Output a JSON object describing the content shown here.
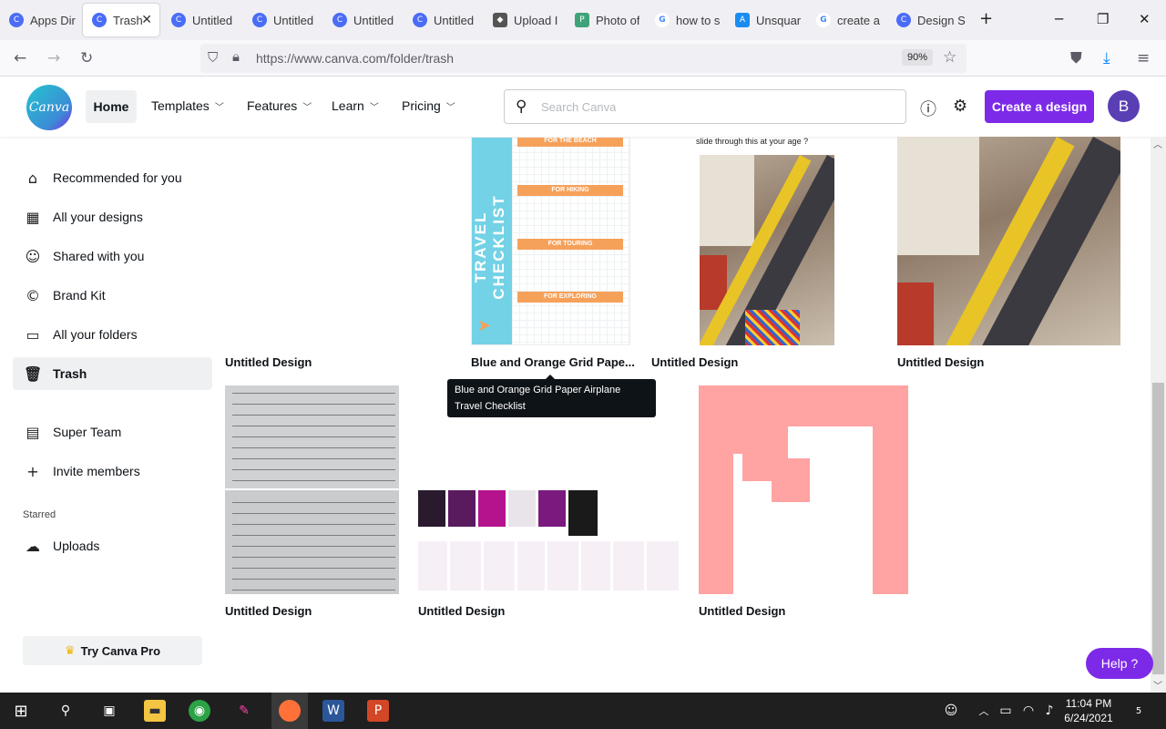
{
  "browser": {
    "tabs": [
      {
        "title": "Apps Dir",
        "icon": "canva-favicon"
      },
      {
        "title": "Trash",
        "icon": "canva-favicon",
        "active": true
      },
      {
        "title": "Untitled",
        "icon": "canva-favicon"
      },
      {
        "title": "Untitled",
        "icon": "canva-favicon"
      },
      {
        "title": "Untitled",
        "icon": "canva-favicon"
      },
      {
        "title": "Untitled",
        "icon": "canva-favicon"
      },
      {
        "title": "Upload I",
        "icon": "layers-favicon"
      },
      {
        "title": "Photo of",
        "icon": "photo-favicon"
      },
      {
        "title": "how to s",
        "icon": "google-favicon"
      },
      {
        "title": "Unsquar",
        "icon": "appstore-favicon"
      },
      {
        "title": "create a",
        "icon": "google-favicon"
      },
      {
        "title": "Design S",
        "icon": "canva-favicon"
      }
    ],
    "url": "https://www.canva.com/folder/trash",
    "zoom": "90%"
  },
  "header": {
    "logo_text": "Canva",
    "home_label": "Home",
    "nav": [
      "Templates",
      "Features",
      "Learn",
      "Pricing"
    ],
    "search_placeholder": "Search Canva",
    "create_label": "Create a design",
    "avatar_initial": "B"
  },
  "sidebar": {
    "items": [
      {
        "label": "Recommended for you",
        "icon": "home-icon"
      },
      {
        "label": "All your designs",
        "icon": "grid-icon"
      },
      {
        "label": "Shared with you",
        "icon": "people-icon"
      },
      {
        "label": "Brand Kit",
        "icon": "brandkit-icon"
      },
      {
        "label": "All your folders",
        "icon": "folder-icon"
      },
      {
        "label": "Trash",
        "icon": "trash-icon",
        "active": true
      },
      {
        "label": "Super Team",
        "icon": "building-icon"
      },
      {
        "label": "Invite members",
        "icon": "plus-icon"
      }
    ],
    "starred_heading": "Starred",
    "starred_items": [
      {
        "label": "Uploads",
        "icon": "cloud-upload-icon"
      }
    ],
    "try_pro": "Try Canva Pro"
  },
  "designs": {
    "row1": [
      "Untitled Design",
      "Blue and Orange Grid Pape...",
      "Untitled Design",
      "Untitled Design"
    ],
    "row2": [
      "Untitled Design",
      "Untitled Design",
      "Untitled Design"
    ],
    "tooltip": "Blue and Orange Grid Paper Airplane Travel Checklist",
    "travel": {
      "vertical_title": "TRAVEL CHECKLIST",
      "bars": [
        "FOR THE BEACH",
        "FOR HIKING",
        "FOR TOURING",
        "FOR EXPLORING"
      ]
    },
    "escalator_caption": "slide through this at your age ?"
  },
  "help_label": "Help ?",
  "taskbar": {
    "time": "11:04 PM",
    "date": "6/24/2021",
    "notifications": "5"
  },
  "colors": {
    "brand_purple": "#7d2ae8",
    "canva_teal": "#25c4cf",
    "travel_blue": "#73d2e6",
    "travel_orange": "#f6a15a",
    "pink": "#ffa3a3"
  }
}
